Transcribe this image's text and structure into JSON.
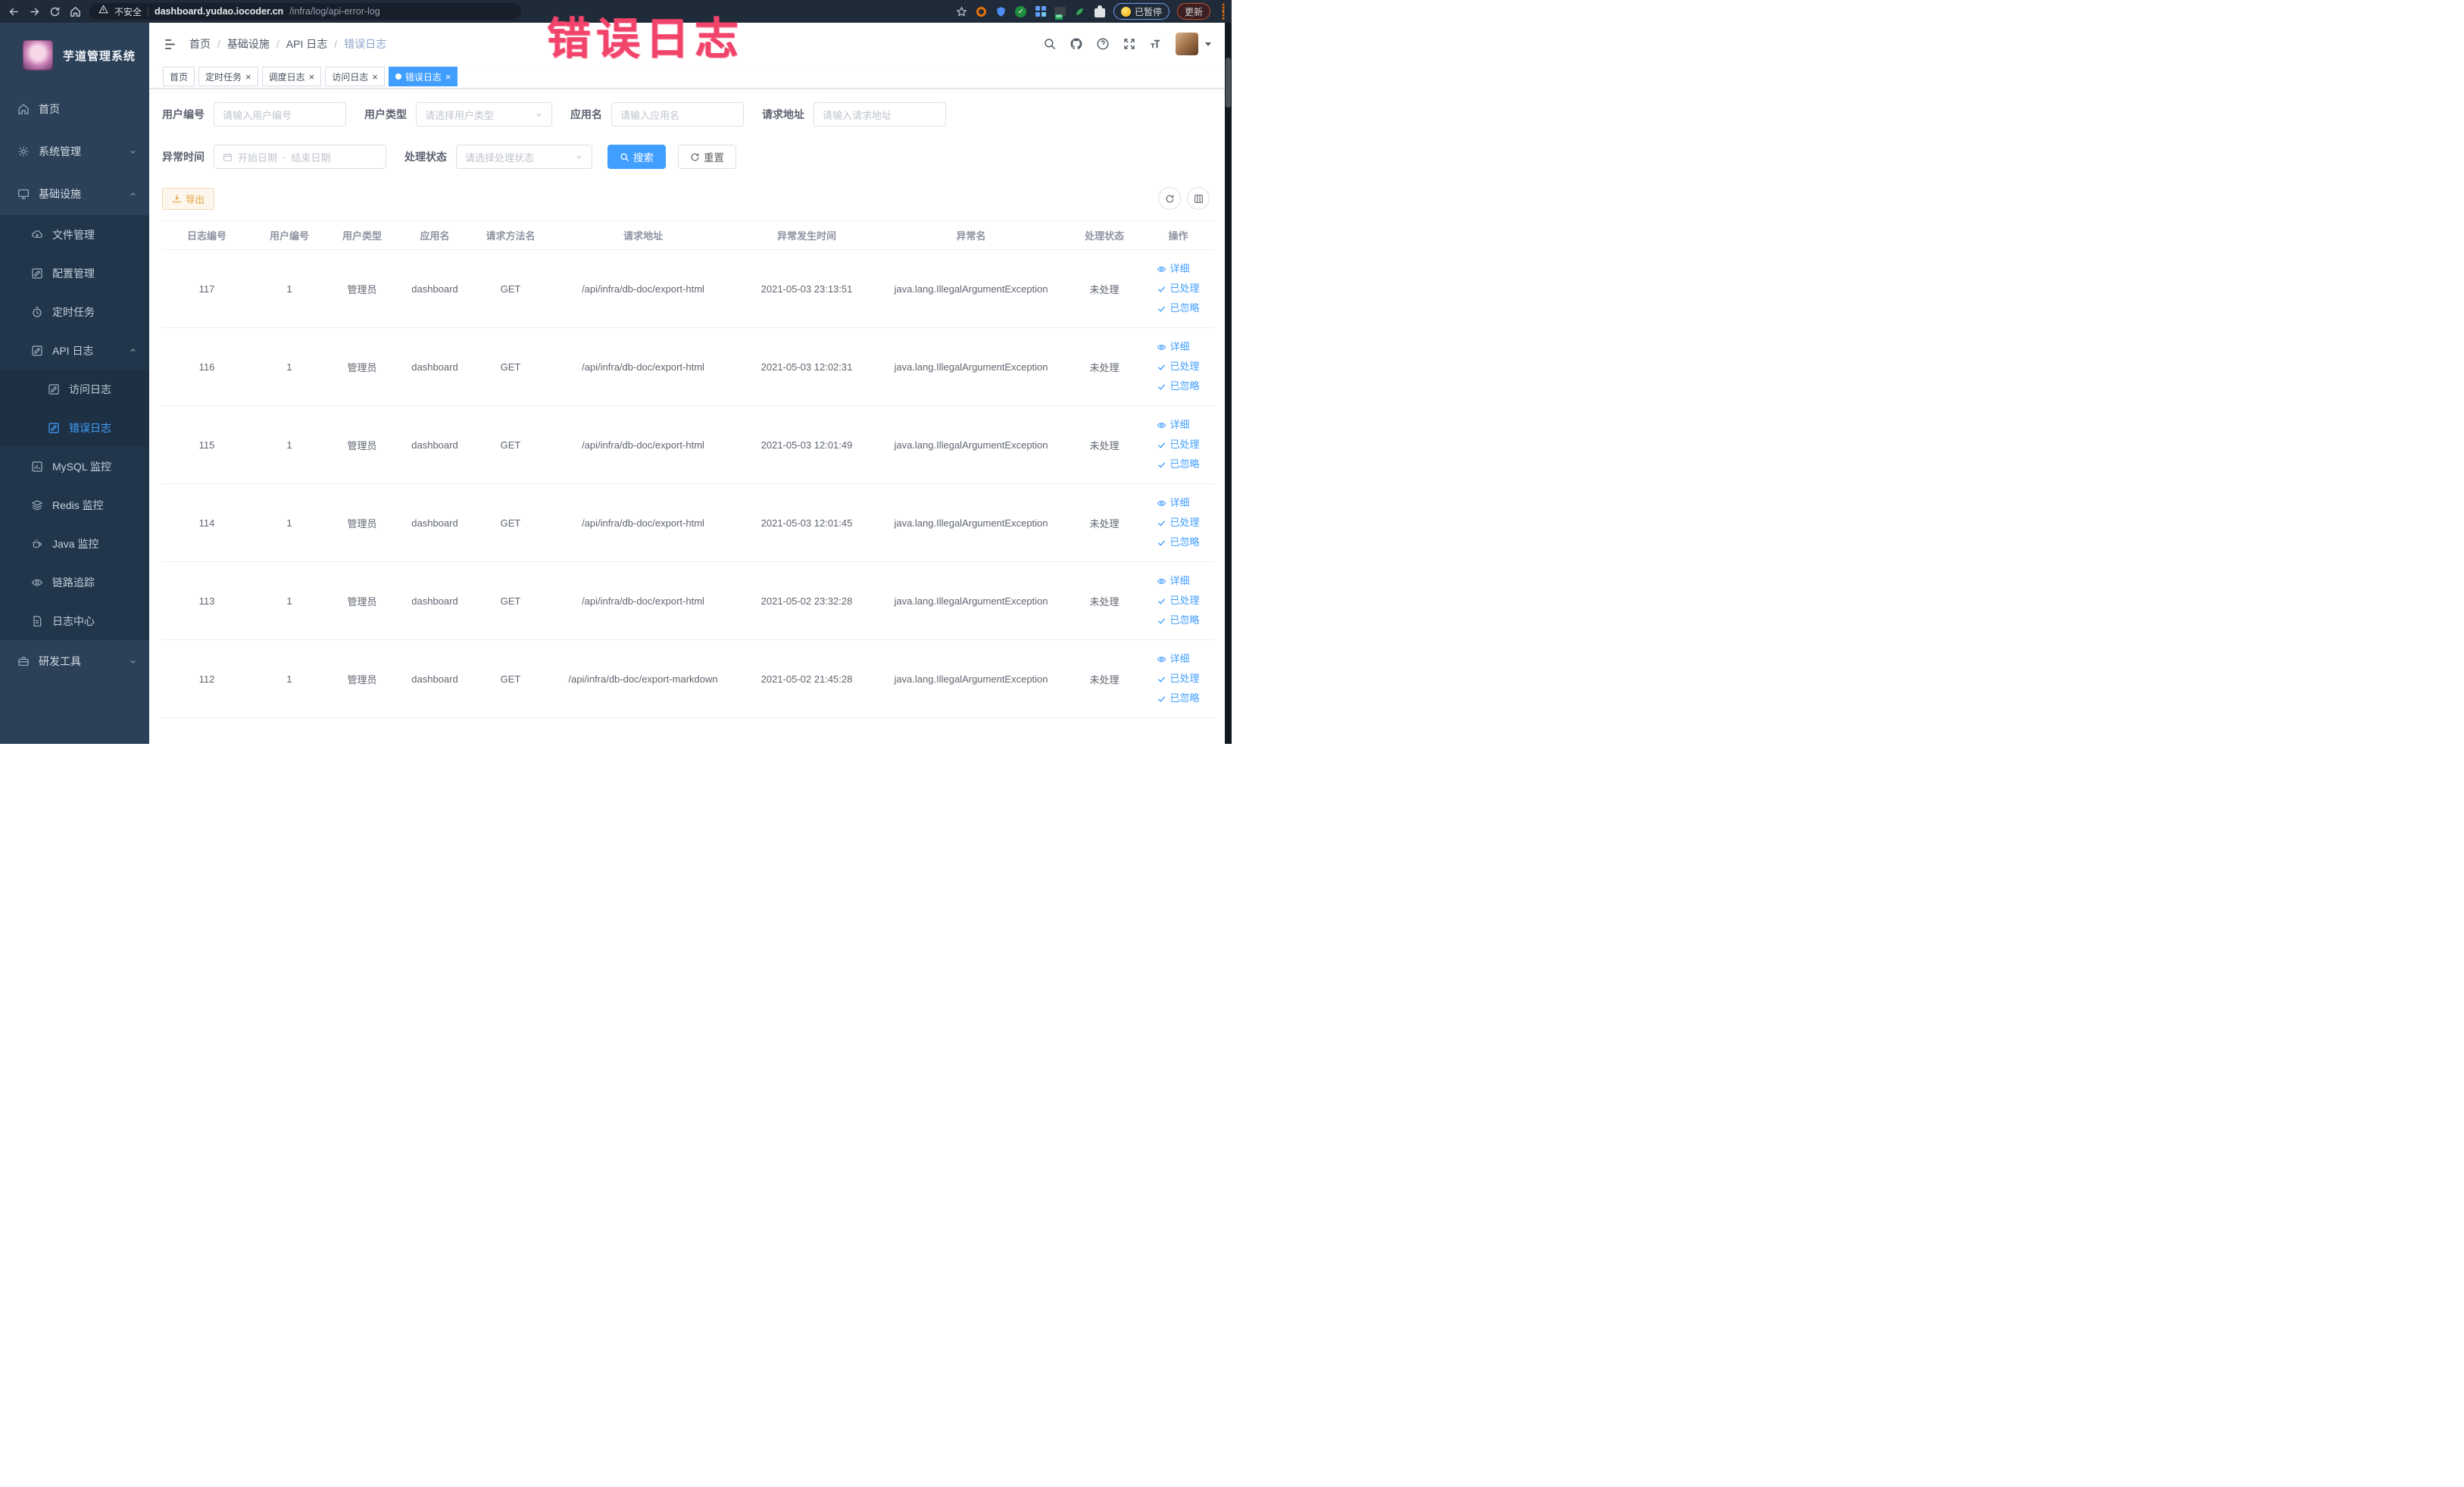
{
  "browser": {
    "security_label": "不安全",
    "url_host": "dashboard.yudao.iocoder.cn",
    "url_path": "/infra/log/api-error-log",
    "paused_badge": "已暂停",
    "update_button": "更新"
  },
  "annotation": {
    "text": "错误日志",
    "color": "#f2436b"
  },
  "sidebar": {
    "app_title": "芋道管理系统",
    "items": [
      {
        "key": "home",
        "label": "首页",
        "icon": "home-icon",
        "level": 0
      },
      {
        "key": "system",
        "label": "系统管理",
        "icon": "gear-icon",
        "level": 0,
        "chevron": "down"
      },
      {
        "key": "infra",
        "label": "基础设施",
        "icon": "monitor-icon",
        "level": 0,
        "chevron": "up"
      },
      {
        "key": "file",
        "label": "文件管理",
        "icon": "cloud-upload-icon",
        "level": 1
      },
      {
        "key": "config",
        "label": "配置管理",
        "icon": "edit-square-icon",
        "level": 1
      },
      {
        "key": "job",
        "label": "定时任务",
        "icon": "timer-icon",
        "level": 1
      },
      {
        "key": "api-log",
        "label": "API 日志",
        "icon": "log-edit-icon",
        "level": 1,
        "chevron": "up"
      },
      {
        "key": "access-log",
        "label": "访问日志",
        "icon": "log-edit-icon",
        "level": 2
      },
      {
        "key": "error-log",
        "label": "错误日志",
        "icon": "log-edit-icon",
        "level": 2,
        "active": true
      },
      {
        "key": "mysql",
        "label": "MySQL 监控",
        "icon": "mysql-chart-icon",
        "level": 1
      },
      {
        "key": "redis",
        "label": "Redis 监控",
        "icon": "redis-layers-icon",
        "level": 1
      },
      {
        "key": "java",
        "label": "Java 监控",
        "icon": "java-coffee-icon",
        "level": 1
      },
      {
        "key": "trace",
        "label": "链路追踪",
        "icon": "trace-eye-icon",
        "level": 1
      },
      {
        "key": "log-center",
        "label": "日志中心",
        "icon": "log-doc-icon",
        "level": 1
      },
      {
        "key": "dev-tools",
        "label": "研发工具",
        "icon": "toolbox-icon",
        "level": 0,
        "chevron": "down"
      }
    ]
  },
  "navbar": {
    "breadcrumb": [
      "首页",
      "基础设施",
      "API 日志",
      "错误日志"
    ]
  },
  "tags": {
    "items": [
      {
        "label": "首页",
        "closable": false,
        "active": false
      },
      {
        "label": "定时任务",
        "closable": true,
        "active": false
      },
      {
        "label": "调度日志",
        "closable": true,
        "active": false
      },
      {
        "label": "访问日志",
        "closable": true,
        "active": false
      },
      {
        "label": "错误日志",
        "closable": true,
        "active": true
      }
    ]
  },
  "filters": {
    "user_id": {
      "label": "用户编号",
      "placeholder": "请输入用户编号"
    },
    "user_type": {
      "label": "用户类型",
      "placeholder": "请选择用户类型"
    },
    "app_name": {
      "label": "应用名",
      "placeholder": "请输入应用名"
    },
    "request_url": {
      "label": "请求地址",
      "placeholder": "请输入请求地址"
    },
    "exception_time": {
      "label": "异常时间",
      "start_placeholder": "开始日期",
      "separator": "-",
      "end_placeholder": "结束日期"
    },
    "process_status": {
      "label": "处理状态",
      "placeholder": "请选择处理状态"
    },
    "search_button": "搜索",
    "reset_button": "重置"
  },
  "toolbar": {
    "export_button": "导出"
  },
  "table": {
    "columns": [
      "日志编号",
      "用户编号",
      "用户类型",
      "应用名",
      "请求方法名",
      "请求地址",
      "异常发生时间",
      "异常名",
      "处理状态",
      "操作"
    ],
    "rows": [
      {
        "id": "117",
        "user_id": "1",
        "user_type": "管理员",
        "app": "dashboard",
        "method": "GET",
        "url": "/api/infra/db-doc/export-html",
        "time": "2021-05-03 23:13:51",
        "exception": "java.lang.IllegalArgumentException",
        "status": "未处理"
      },
      {
        "id": "116",
        "user_id": "1",
        "user_type": "管理员",
        "app": "dashboard",
        "method": "GET",
        "url": "/api/infra/db-doc/export-html",
        "time": "2021-05-03 12:02:31",
        "exception": "java.lang.IllegalArgumentException",
        "status": "未处理"
      },
      {
        "id": "115",
        "user_id": "1",
        "user_type": "管理员",
        "app": "dashboard",
        "method": "GET",
        "url": "/api/infra/db-doc/export-html",
        "time": "2021-05-03 12:01:49",
        "exception": "java.lang.IllegalArgumentException",
        "status": "未处理"
      },
      {
        "id": "114",
        "user_id": "1",
        "user_type": "管理员",
        "app": "dashboard",
        "method": "GET",
        "url": "/api/infra/db-doc/export-html",
        "time": "2021-05-03 12:01:45",
        "exception": "java.lang.IllegalArgumentException",
        "status": "未处理"
      },
      {
        "id": "113",
        "user_id": "1",
        "user_type": "管理员",
        "app": "dashboard",
        "method": "GET",
        "url": "/api/infra/db-doc/export-html",
        "time": "2021-05-02 23:32:28",
        "exception": "java.lang.IllegalArgumentException",
        "status": "未处理"
      },
      {
        "id": "112",
        "user_id": "1",
        "user_type": "管理员",
        "app": "dashboard",
        "method": "GET",
        "url": "/api/infra/db-doc/export-markdown",
        "time": "2021-05-02 21:45:28",
        "exception": "java.lang.IllegalArgumentException",
        "status": "未处理"
      }
    ],
    "row_actions": [
      "详细",
      "已处理",
      "已忽略"
    ]
  },
  "colors": {
    "accent": "#409eff",
    "warning": "#e6a23c",
    "sidebar_bg": "#2c4158",
    "submenu_bg": "#22364b"
  }
}
